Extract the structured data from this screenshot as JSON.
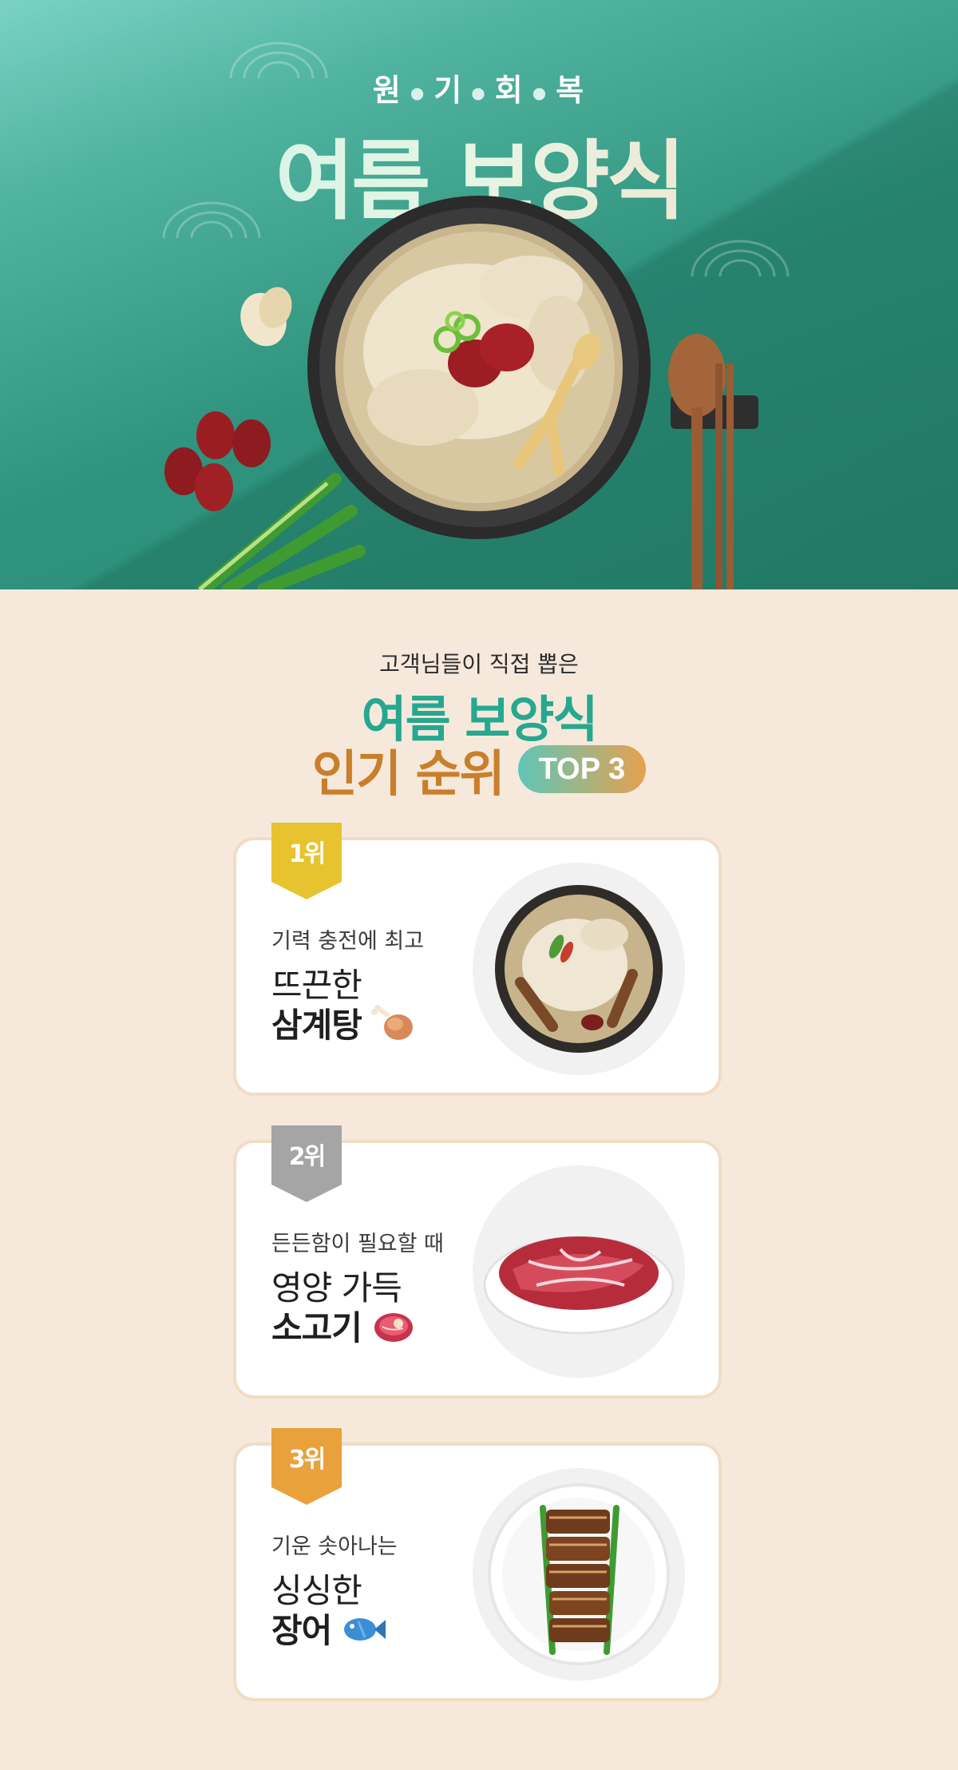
{
  "hero": {
    "subtitle_chars": [
      "원",
      "기",
      "회",
      "복"
    ],
    "title": "여름 보양식"
  },
  "ranking": {
    "lead": "고객님들이 직접 뽑은",
    "title_line1": "여름 보양식",
    "title_line2": "인기 순위",
    "pill": "TOP 3"
  },
  "cards": [
    {
      "rank": "1위",
      "subtitle": "기력 충전에 최고",
      "line1": "뜨끈한",
      "line2": "삼계탕",
      "icon": "chicken-leg-icon",
      "badge_color": "#e7c32f"
    },
    {
      "rank": "2위",
      "subtitle": "든든함이 필요할 때",
      "line1": "영양 가득",
      "line2": "소고기",
      "icon": "steak-icon",
      "badge_color": "#a5a5a5"
    },
    {
      "rank": "3위",
      "subtitle": "기운 솟아나는",
      "line1": "싱싱한",
      "line2": "장어",
      "icon": "fish-icon",
      "badge_color": "#e9a13c"
    }
  ],
  "colors": {
    "teal": "#26a88f",
    "orange": "#c97f2a",
    "background": "#f6e9dc"
  }
}
